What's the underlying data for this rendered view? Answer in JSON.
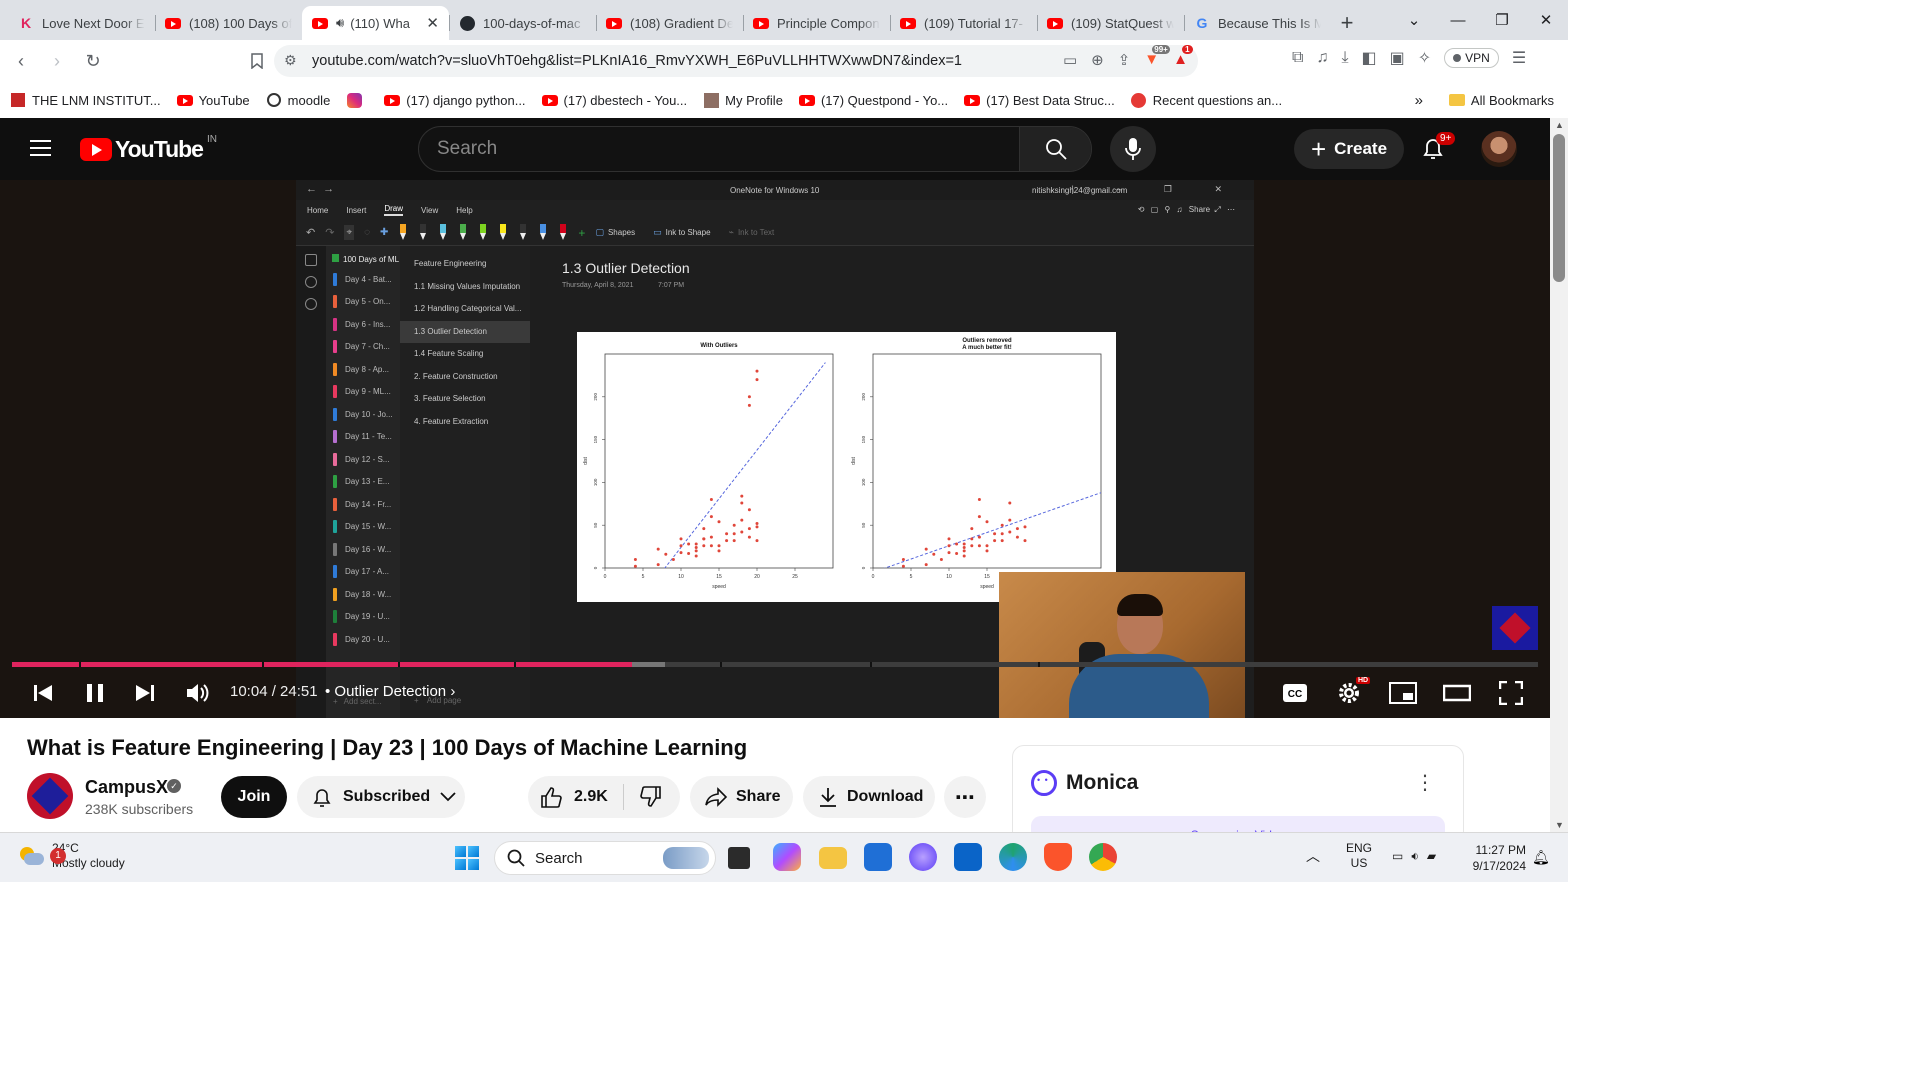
{
  "browser": {
    "tabs": [
      {
        "title": "Love Next Door E",
        "icon": "k-icon",
        "active": false
      },
      {
        "title": "(108) 100 Days of",
        "icon": "youtube-icon",
        "active": false
      },
      {
        "title": "(110) Wha",
        "icon": "youtube-icon",
        "active": true,
        "audio": true
      },
      {
        "title": "100-days-of-mac",
        "icon": "github-icon",
        "active": false
      },
      {
        "title": "(108) Gradient De",
        "icon": "youtube-icon",
        "active": false
      },
      {
        "title": "Principle Compon",
        "icon": "youtube-icon",
        "active": false
      },
      {
        "title": "(109) Tutorial 17-",
        "icon": "youtube-icon",
        "active": false
      },
      {
        "title": "(109) StatQuest w",
        "icon": "youtube-icon",
        "active": false
      },
      {
        "title": "Because This Is M",
        "icon": "google-icon",
        "active": false
      }
    ],
    "url": "youtube.com/watch?v=sluoVhT0ehg&list=PLKnIA16_RmvYXWH_E6PuVLLHHTWXwwDN7&index=1",
    "brave_badge": "99+",
    "alert_badge": "1",
    "vpn_label": "VPN",
    "bookmarks": [
      {
        "label": "THE LNM INSTITUT...",
        "icon": "lnmiit-icon"
      },
      {
        "label": "YouTube",
        "icon": "youtube-icon"
      },
      {
        "label": "moodle",
        "icon": "moodle-icon"
      },
      {
        "label": "",
        "icon": "instagram-icon"
      },
      {
        "label": "(17) django python...",
        "icon": "youtube-icon"
      },
      {
        "label": "(17) dbestech - You...",
        "icon": "youtube-icon"
      },
      {
        "label": "My Profile",
        "icon": "profile-icon"
      },
      {
        "label": "(17) Questpond - Yo...",
        "icon": "youtube-icon"
      },
      {
        "label": "(17) Best Data Struc...",
        "icon": "youtube-icon"
      },
      {
        "label": "Recent questions an...",
        "icon": "questions-icon"
      }
    ],
    "all_bookmarks": "All Bookmarks"
  },
  "youtube": {
    "logo_text": "YouTube",
    "country_code": "IN",
    "search_placeholder": "Search",
    "create_label": "Create",
    "notif_count": "9+",
    "player": {
      "time": "10:04 / 24:51",
      "chapter": "Outlier Detection",
      "progress_fraction": 0.4064,
      "buffered_fraction": 0.428,
      "hd_badge": "HD"
    },
    "video_title": "What is Feature Engineering | Day 23 | 100 Days of Machine Learning",
    "channel": {
      "name": "CampusX",
      "subscribers": "238K subscribers"
    },
    "join_label": "Join",
    "subscribed_label": "Subscribed",
    "likes": "2.9K",
    "share_label": "Share",
    "download_label": "Download",
    "monica": {
      "name": "Monica",
      "strip": "Summarize Video"
    }
  },
  "onenote": {
    "window_title": "OneNote for Windows 10",
    "account": "nitishksingh24@gmail.com",
    "menu": [
      "Home",
      "Insert",
      "Draw",
      "View",
      "Help"
    ],
    "share": "Share",
    "ribbon": {
      "shapes": "Shapes",
      "ink_to_shape": "Ink to Shape",
      "ink_to_text": "Ink to Text"
    },
    "pen_colors": [
      "#f5a623",
      "#333333",
      "#5bc0de",
      "#4cae4c",
      "#7ed321",
      "#f8e71c",
      "#333333",
      "#4a90e2",
      "#d0021b"
    ],
    "notebook": "100 Days of ML",
    "sections": [
      {
        "label": "Day 4 - Bat...",
        "color": "#2f7bd8"
      },
      {
        "label": "Day 5 - On...",
        "color": "#e8603c"
      },
      {
        "label": "Day 6 - Ins...",
        "color": "#d63384"
      },
      {
        "label": "Day 7 - Ch...",
        "color": "#e83e8c"
      },
      {
        "label": "Day 8 - Ap...",
        "color": "#f08a24"
      },
      {
        "label": "Day 9 - ML...",
        "color": "#e8395f"
      },
      {
        "label": "Day 10 - Jo...",
        "color": "#2f7bd8"
      },
      {
        "label": "Day 11 - Te...",
        "color": "#b66fd0"
      },
      {
        "label": "Day 12 - S...",
        "color": "#e86b9a"
      },
      {
        "label": "Day 13 - E...",
        "color": "#2ea043"
      },
      {
        "label": "Day 14 - Fr...",
        "color": "#e8603c"
      },
      {
        "label": "Day 15 - W...",
        "color": "#1fa39a"
      },
      {
        "label": "Day 16 - W...",
        "color": "#777777"
      },
      {
        "label": "Day 17 - A...",
        "color": "#2f7bd8"
      },
      {
        "label": "Day 18 - W...",
        "color": "#f0a020"
      },
      {
        "label": "Day 19 - U...",
        "color": "#1e7f3a"
      },
      {
        "label": "Day 20 - U...",
        "color": "#e8395f"
      }
    ],
    "pages": [
      {
        "label": "Feature Engineering",
        "selected": false
      },
      {
        "label": "1.1 Missing Values Imputation",
        "selected": false
      },
      {
        "label": "1.2 Handling Categorical Val...",
        "selected": false
      },
      {
        "label": "1.3 Outlier Detection",
        "selected": true
      },
      {
        "label": "1.4 Feature Scaling",
        "selected": false
      },
      {
        "label": "2. Feature Construction",
        "selected": false
      },
      {
        "label": "3. Feature Selection",
        "selected": false
      },
      {
        "label": "4. Feature Extraction",
        "selected": false
      }
    ],
    "page_title": "1.3 Outlier Detection",
    "page_date": "Thursday, April 8, 2021",
    "page_time": "7:07 PM",
    "add_section": "Add sect...",
    "add_page": "Add page"
  },
  "chart_data": [
    {
      "type": "scatter",
      "title": "With Outliers",
      "xlabel": "speed",
      "ylabel": "dist",
      "xlim": [
        0,
        30
      ],
      "ylim": [
        0,
        250
      ],
      "xticks": [
        0,
        5,
        10,
        15,
        20,
        25
      ],
      "yticks": [
        0,
        50,
        100,
        150,
        200
      ],
      "points": [
        [
          4,
          2
        ],
        [
          4,
          10
        ],
        [
          7,
          4
        ],
        [
          7,
          22
        ],
        [
          8,
          16
        ],
        [
          9,
          10
        ],
        [
          10,
          18
        ],
        [
          10,
          26
        ],
        [
          10,
          34
        ],
        [
          11,
          17
        ],
        [
          11,
          28
        ],
        [
          12,
          14
        ],
        [
          12,
          20
        ],
        [
          12,
          24
        ],
        [
          12,
          28
        ],
        [
          13,
          26
        ],
        [
          13,
          34
        ],
        [
          13,
          34
        ],
        [
          13,
          46
        ],
        [
          14,
          26
        ],
        [
          14,
          36
        ],
        [
          14,
          60
        ],
        [
          14,
          80
        ],
        [
          15,
          20
        ],
        [
          15,
          26
        ],
        [
          15,
          54
        ],
        [
          16,
          32
        ],
        [
          16,
          40
        ],
        [
          17,
          32
        ],
        [
          17,
          40
        ],
        [
          17,
          50
        ],
        [
          18,
          42
        ],
        [
          18,
          56
        ],
        [
          18,
          76
        ],
        [
          18,
          84
        ],
        [
          19,
          36
        ],
        [
          19,
          46
        ],
        [
          19,
          68
        ],
        [
          20,
          32
        ],
        [
          20,
          48
        ],
        [
          20,
          52
        ],
        [
          19,
          190
        ],
        [
          19,
          200
        ],
        [
          20,
          220
        ],
        [
          20,
          230
        ]
      ],
      "fit_line": [
        [
          7,
          -10
        ],
        [
          29,
          240
        ]
      ]
    },
    {
      "type": "scatter",
      "title": "Outliers removed\nA much better fit!",
      "xlabel": "speed",
      "ylabel": "dist",
      "xlim": [
        0,
        30
      ],
      "ylim": [
        0,
        250
      ],
      "xticks": [
        0,
        5,
        10,
        15
      ],
      "yticks": [
        0,
        50,
        100,
        150,
        200
      ],
      "points": [
        [
          4,
          2
        ],
        [
          4,
          10
        ],
        [
          7,
          4
        ],
        [
          7,
          22
        ],
        [
          8,
          16
        ],
        [
          9,
          10
        ],
        [
          10,
          18
        ],
        [
          10,
          26
        ],
        [
          10,
          34
        ],
        [
          11,
          17
        ],
        [
          11,
          28
        ],
        [
          12,
          14
        ],
        [
          12,
          20
        ],
        [
          12,
          24
        ],
        [
          12,
          28
        ],
        [
          13,
          26
        ],
        [
          13,
          34
        ],
        [
          13,
          46
        ],
        [
          14,
          26
        ],
        [
          14,
          36
        ],
        [
          14,
          60
        ],
        [
          14,
          80
        ],
        [
          15,
          20
        ],
        [
          15,
          26
        ],
        [
          15,
          54
        ],
        [
          16,
          32
        ],
        [
          16,
          40
        ],
        [
          17,
          32
        ],
        [
          17,
          40
        ],
        [
          17,
          50
        ],
        [
          18,
          42
        ],
        [
          18,
          56
        ],
        [
          18,
          76
        ],
        [
          19,
          36
        ],
        [
          19,
          46
        ],
        [
          20,
          32
        ],
        [
          20,
          48
        ]
      ],
      "fit_line": [
        [
          0,
          -5
        ],
        [
          30,
          88
        ]
      ]
    }
  ],
  "taskbar": {
    "weather_badge": "1",
    "temperature": "24°C",
    "condition": "Mostly cloudy",
    "search_label": "Search",
    "language": "ENG",
    "region": "US",
    "time": "11:27 PM",
    "date": "9/17/2024"
  }
}
